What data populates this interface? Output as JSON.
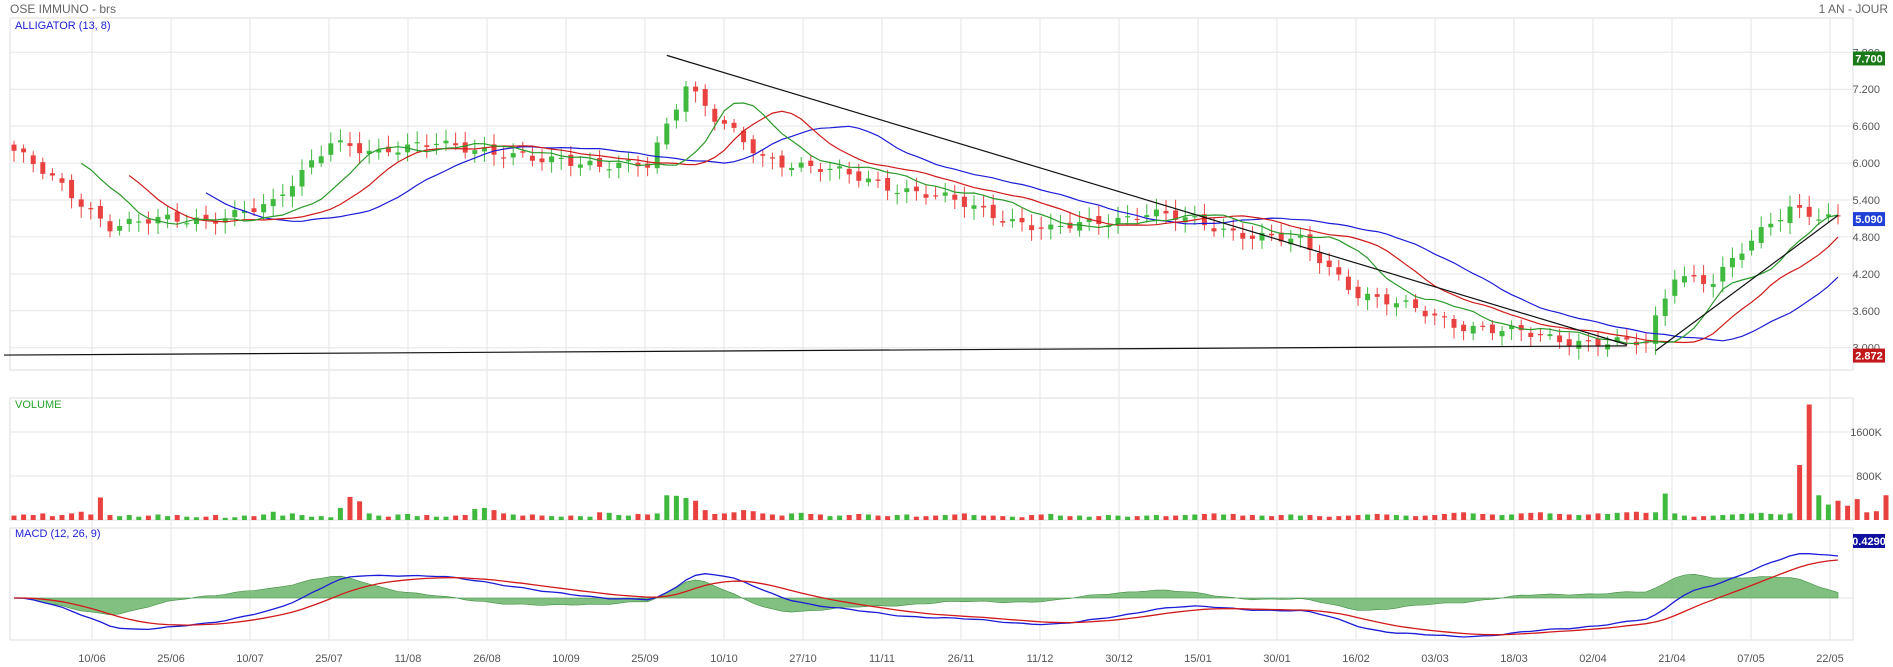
{
  "header": {
    "title": "OSE IMMUNO - brs",
    "period": "1 AN - JOUR"
  },
  "panels": {
    "price_label": "ALLIGATOR (13, 8)",
    "volume_label": "VOLUME",
    "macd_label": "MACD (12, 26, 9)"
  },
  "colors": {
    "up": "#3fba3f",
    "down": "#e8413f",
    "blue": "#1c1cd6",
    "red": "#d01a1a",
    "green": "#2a9a2a",
    "histogram": "#6cb56c",
    "grid": "#e6e6e6",
    "tag_top": "#1a7a1a",
    "tag_last": "#1f3fd6",
    "tag_low": "#c0181b",
    "tag_macd": "#1010a0"
  },
  "chart_data": {
    "type": "candlestick",
    "x_ticks": [
      "10/06",
      "25/06",
      "10/07",
      "25/07",
      "11/08",
      "26/08",
      "10/09",
      "25/09",
      "10/10",
      "27/10",
      "11/11",
      "26/11",
      "11/12",
      "30/12",
      "15/01",
      "30/01",
      "16/02",
      "03/03",
      "18/03",
      "02/04",
      "21/04",
      "07/05",
      "22/05"
    ],
    "price_axis": {
      "ticks": [
        "7.800",
        "7.200",
        "6.600",
        "6.000",
        "5.400",
        "4.800",
        "4.200",
        "3.600",
        "3.000"
      ],
      "ylim": [
        2.8,
        8.0
      ],
      "tags": {
        "top": "7.700",
        "last": "5.090",
        "low": "2.872"
      }
    },
    "close_anchors": [
      [
        0,
        6.2
      ],
      [
        10,
        5.0
      ],
      [
        20,
        5.1
      ],
      [
        27,
        5.3
      ],
      [
        33,
        6.4
      ],
      [
        38,
        6.1
      ],
      [
        44,
        6.4
      ],
      [
        50,
        6.1
      ],
      [
        57,
        6.1
      ],
      [
        61,
        5.9
      ],
      [
        66,
        6.0
      ],
      [
        70,
        7.3
      ],
      [
        73,
        6.7
      ],
      [
        78,
        6.1
      ],
      [
        84,
        5.9
      ],
      [
        95,
        5.5
      ],
      [
        108,
        4.9
      ],
      [
        118,
        5.2
      ],
      [
        127,
        4.9
      ],
      [
        134,
        4.7
      ],
      [
        140,
        3.9
      ],
      [
        150,
        3.4
      ],
      [
        160,
        3.15
      ],
      [
        170,
        3.05
      ],
      [
        173,
        4.2
      ],
      [
        177,
        4.1
      ],
      [
        185,
        5.3
      ],
      [
        190,
        5.09
      ]
    ],
    "volume_axis": {
      "ticks": [
        "1600K",
        "800K"
      ],
      "ylim": [
        0,
        2000
      ]
    },
    "volume_values_k": [
      80,
      100,
      90,
      120,
      70,
      90,
      120,
      150,
      100,
      410,
      90,
      70,
      90,
      60,
      80,
      100,
      70,
      90,
      60,
      50,
      60,
      90,
      40,
      50,
      80,
      70,
      100,
      150,
      80,
      120,
      90,
      60,
      70,
      50,
      220,
      420,
      340,
      120,
      80,
      60,
      100,
      110,
      70,
      90,
      60,
      60,
      80,
      90,
      200,
      220,
      180,
      120,
      100,
      80,
      100,
      80,
      70,
      60,
      80,
      70,
      60,
      140,
      130,
      90,
      80,
      110,
      100,
      120,
      450,
      440,
      400,
      350,
      180,
      110,
      120,
      140,
      180,
      160,
      120,
      100,
      80,
      120,
      130,
      110,
      100,
      70,
      80,
      90,
      110,
      100,
      80,
      70,
      90,
      100,
      60,
      70,
      80,
      90,
      100,
      120,
      90,
      80,
      80,
      70,
      60,
      50,
      90,
      100,
      110,
      80,
      70,
      80,
      60,
      70,
      90,
      80,
      60,
      70,
      80,
      90,
      70,
      80,
      90,
      100,
      110,
      120,
      100,
      110,
      80,
      90,
      80,
      70,
      90,
      100,
      80,
      90,
      70,
      60,
      70,
      80,
      90,
      100,
      110,
      100,
      90,
      80,
      70,
      80,
      90,
      110,
      130,
      140,
      120,
      110,
      100,
      90,
      100,
      120,
      130,
      140,
      120,
      110,
      100,
      90,
      100,
      120,
      110,
      130,
      140,
      150,
      130,
      140,
      480,
      120,
      80,
      60,
      70,
      80,
      90,
      100,
      110,
      120,
      130,
      110,
      100,
      120,
      1000,
      2100,
      450,
      280,
      350,
      260,
      380,
      140,
      160,
      450,
      260,
      900,
      1050,
      420,
      400,
      350,
      1000,
      200
    ],
    "macd_axis": {
      "ylim": [
        -0.5,
        0.5
      ],
      "tags": {
        "value": "0.4290"
      }
    }
  }
}
